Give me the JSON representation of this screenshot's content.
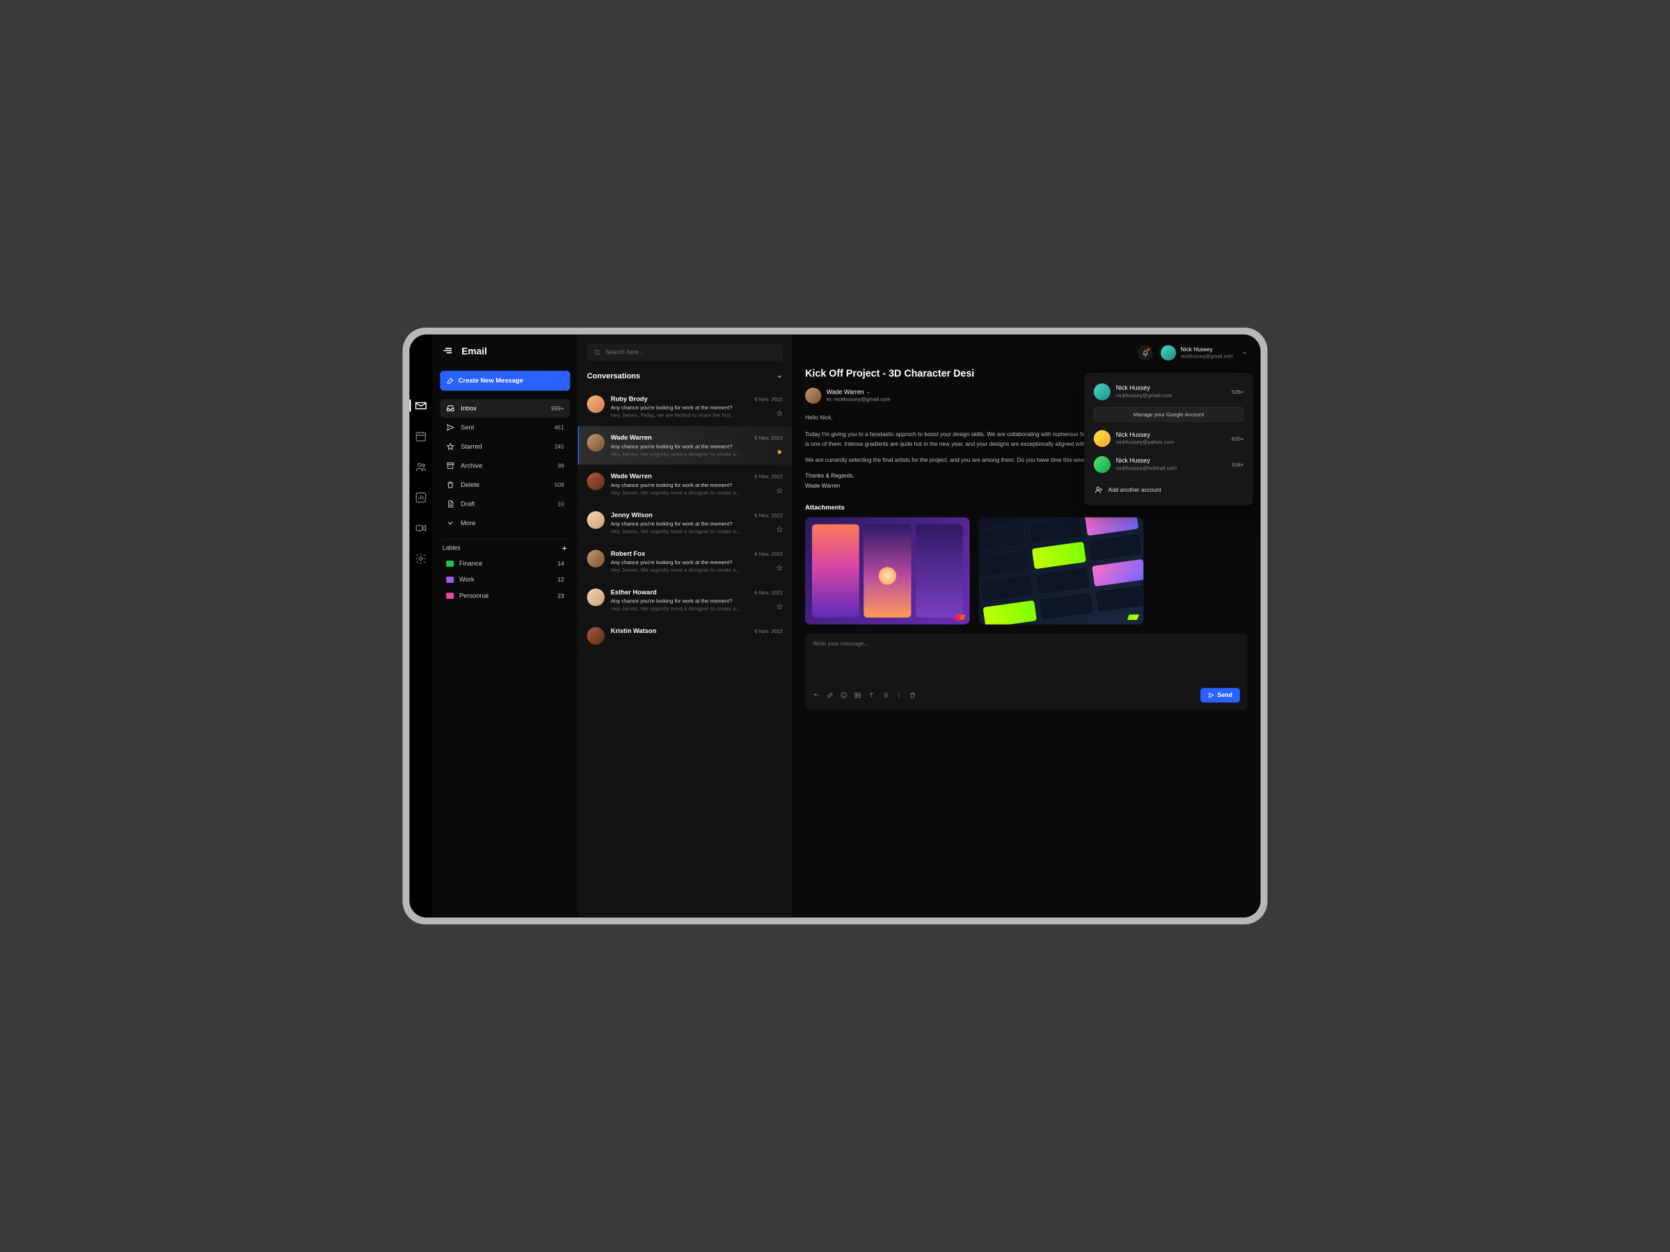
{
  "brand": "Email",
  "create_label": "Create New Message",
  "nav": {
    "items": [
      {
        "label": "Inbox",
        "count": "999+"
      },
      {
        "label": "Sent",
        "count": "451"
      },
      {
        "label": "Starred",
        "count": "245"
      },
      {
        "label": "Archive",
        "count": "99"
      },
      {
        "label": "Delete",
        "count": "509"
      },
      {
        "label": "Draft",
        "count": "10"
      },
      {
        "label": "More",
        "count": ""
      }
    ]
  },
  "labels": {
    "title": "Lables",
    "items": [
      {
        "label": "Finance",
        "count": "14",
        "color": "#22c55e"
      },
      {
        "label": "Work",
        "count": "12",
        "color": "#a855f7"
      },
      {
        "label": "Personnal",
        "count": "23",
        "color": "#ec4899"
      }
    ]
  },
  "search": {
    "placeholder": "Search here..."
  },
  "convos": {
    "title": "Conversations",
    "items": [
      {
        "name": "Ruby Brody",
        "date": "6 Nov, 2022",
        "subject": "Any chance you're looking for work at the mement?",
        "preview": "Hey James, Today, we are thrilled to share the first…",
        "starred": false
      },
      {
        "name": "Wade Warren",
        "date": "6 Nov, 2022",
        "subject": "Any chance you're looking for work at the mement?",
        "preview": "Hey James, We urgently need a designer to create a...",
        "starred": true
      },
      {
        "name": "Wade Warren",
        "date": "6 Nov, 2022",
        "subject": "Any chance you're looking for work at the mement?",
        "preview": "Hey James, We urgently need a designer to create a...",
        "starred": false
      },
      {
        "name": "Jenny Wilson",
        "date": "6 Nov, 2022",
        "subject": "Any chance you're looking for work at the mement?",
        "preview": "Hey James, We urgently need a designer to create a...",
        "starred": false
      },
      {
        "name": "Robert Fox",
        "date": "6 Nov, 2022",
        "subject": "Any chance you're looking for work at the mement?",
        "preview": "Hey James, We urgently need a designer to create a...",
        "starred": false
      },
      {
        "name": "Esther Howard",
        "date": "6 Nov, 2022",
        "subject": "Any chance you're looking for work at the mement?",
        "preview": "Hey James, We urgently need a designer to create a...",
        "starred": false
      },
      {
        "name": "Kristin Watson",
        "date": "6 Nov, 2022",
        "subject": "",
        "preview": "",
        "starred": false
      }
    ]
  },
  "detail": {
    "subject": "Kick Off Project - 3D Character Desi",
    "from_name": "Wade Warren",
    "to_line": "to: nickhussey@gmail.com",
    "greeting": "Hello Nick,",
    "para1": "Today I'm giving you to a fanstastic approch to boost your design skills. We are collaborating with numerous firms of notabel professionals in this industry, and your company is one of them. Intense gradients are quite hot in the new year, and your designs are exceptionally aligned with the current trend. Check out the images below.",
    "para2": "We are currently selecting the final artists for the project, and you are among them. Do you have time this week for a brief zoom chat to discuss potential engagement?",
    "thanks": "Thanks & Regards,",
    "signoff": "Wade Warren",
    "attach_title": "Attachments"
  },
  "compose": {
    "placeholder": "Write your message...",
    "send": "Send"
  },
  "user": {
    "name": "Nick Hussey",
    "email": "nickhussey@gmail.com"
  },
  "accounts": {
    "manage": "Manage your Google Account",
    "add": "Add another account",
    "items": [
      {
        "name": "Nick Hussey",
        "email": "nickhussey@gmail.com",
        "badge": "528+"
      },
      {
        "name": "Nick Hussey",
        "email": "nickhussey@yahoo.com",
        "badge": "620+"
      },
      {
        "name": "Nick Hussey",
        "email": "nickhussey@hotmail.com",
        "badge": "318+"
      }
    ]
  }
}
